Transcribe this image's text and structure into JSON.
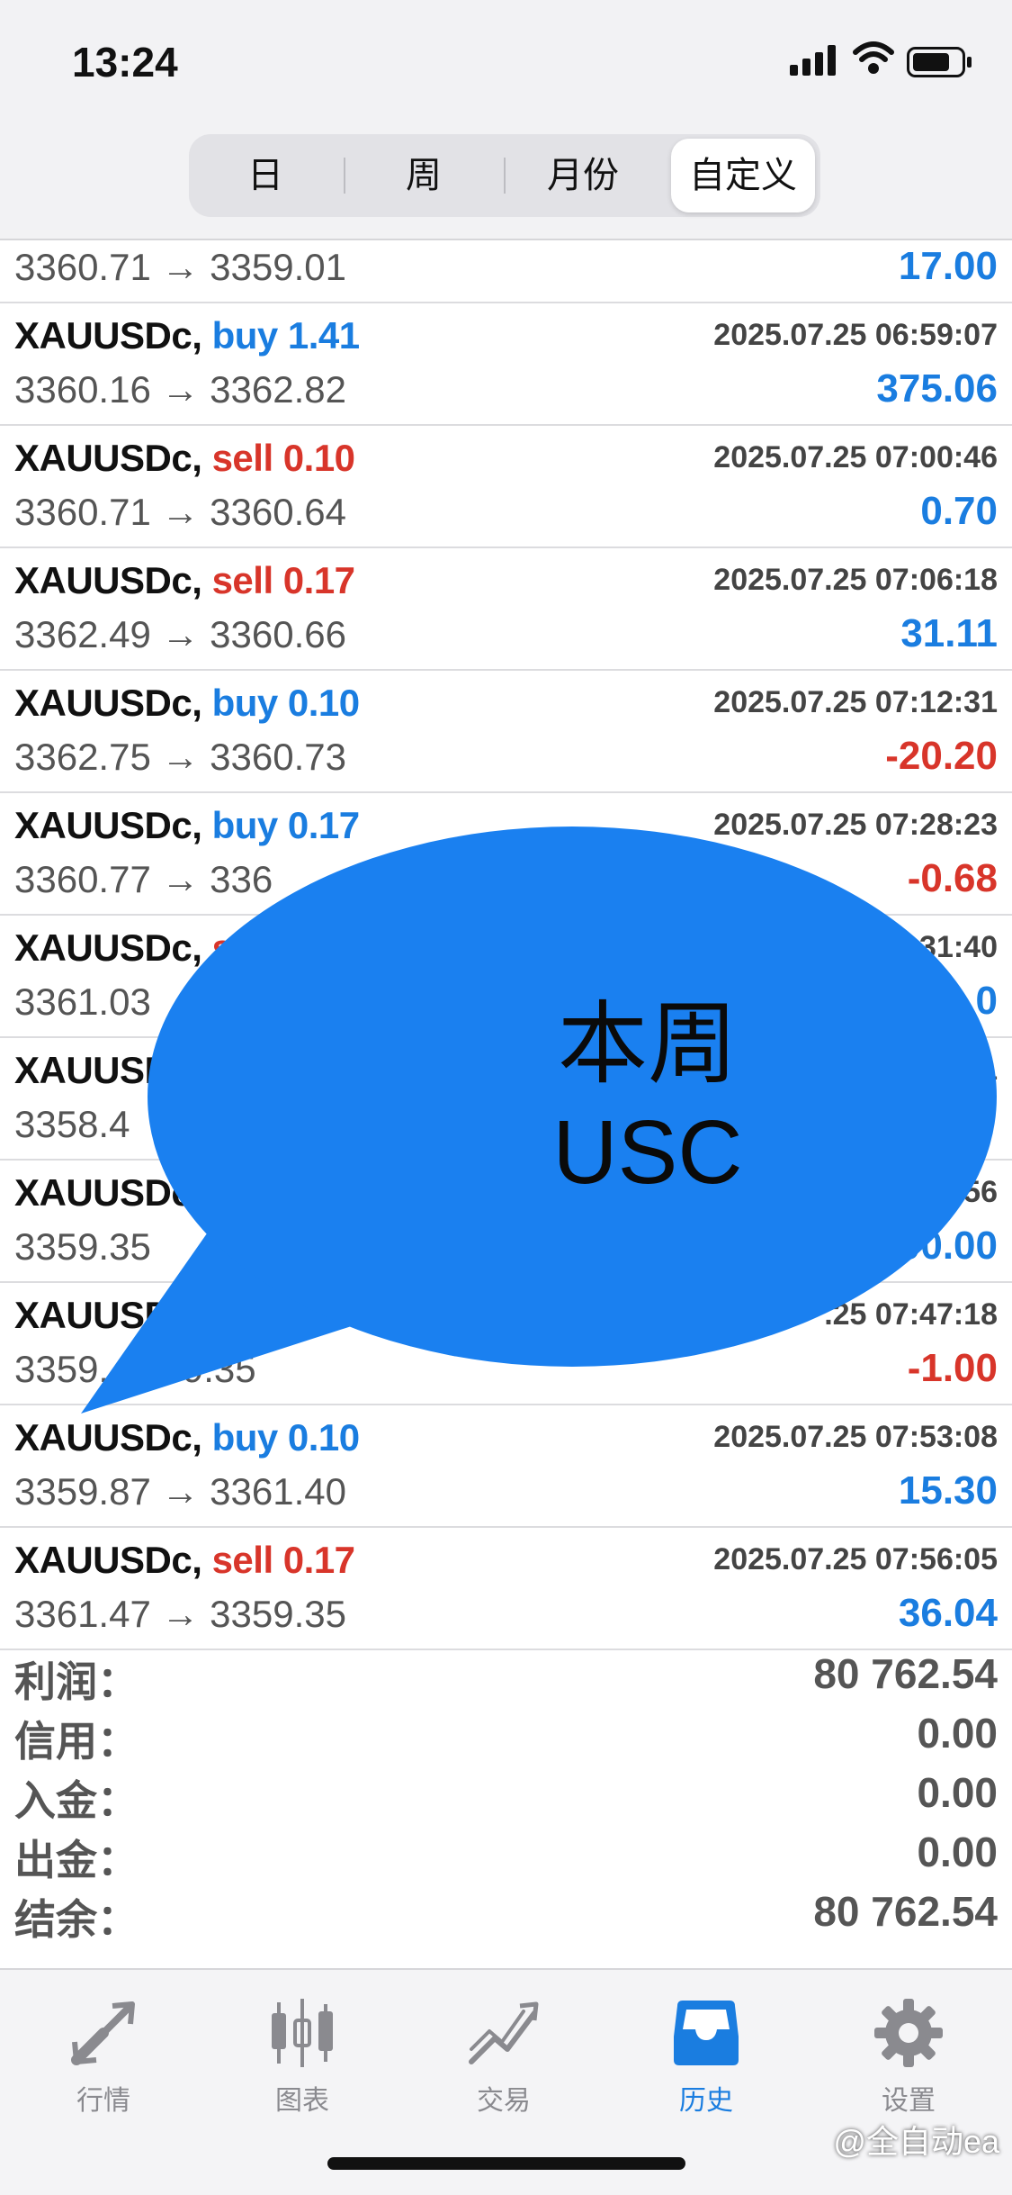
{
  "status": {
    "time": "13:24"
  },
  "segments": {
    "items": [
      "日",
      "周",
      "月份",
      "自定义"
    ],
    "active": "自定义"
  },
  "trades": [
    {
      "symbol": "",
      "side": "",
      "volume": "",
      "datetime": "",
      "prices": "3360.71 → 3359.01",
      "profit": "17.00",
      "profit_sign": "pos"
    },
    {
      "symbol": "XAUUSDc,",
      "side": "buy",
      "volume": "1.41",
      "datetime": "2025.07.25 06:59:07",
      "prices": "3360.16 → 3362.82",
      "profit": "375.06",
      "profit_sign": "pos"
    },
    {
      "symbol": "XAUUSDc,",
      "side": "sell",
      "volume": "0.10",
      "datetime": "2025.07.25 07:00:46",
      "prices": "3360.71 → 3360.64",
      "profit": "0.70",
      "profit_sign": "pos"
    },
    {
      "symbol": "XAUUSDc,",
      "side": "sell",
      "volume": "0.17",
      "datetime": "2025.07.25 07:06:18",
      "prices": "3362.49 → 3360.66",
      "profit": "31.11",
      "profit_sign": "pos"
    },
    {
      "symbol": "XAUUSDc,",
      "side": "buy",
      "volume": "0.10",
      "datetime": "2025.07.25 07:12:31",
      "prices": "3362.75 → 3360.73",
      "profit": "-20.20",
      "profit_sign": "neg"
    },
    {
      "symbol": "XAUUSDc,",
      "side": "buy",
      "volume": "0.17",
      "datetime": "2025.07.25 07:28:23",
      "prices": "3360.77 → 336",
      "profit": "-0.68",
      "profit_sign": "neg"
    },
    {
      "symbol": "XAUUSDc,",
      "side": "se",
      "volume": "",
      "datetime": "31:40",
      "prices": "3361.03",
      "profit": "0",
      "profit_sign": "pos"
    },
    {
      "symbol": "XAUUSD",
      "side": "",
      "volume": "",
      "datetime": "1",
      "prices": "3358.4",
      "profit": "",
      "profit_sign": "pos"
    },
    {
      "symbol": "XAUUSDc,",
      "side": "",
      "volume": "",
      "datetime": "56",
      "prices": "3359.35",
      "profit": "00.00",
      "profit_sign": "pos"
    },
    {
      "symbol": "XAUUSD",
      "side": "",
      "volume": "",
      "datetime": ".25 07:47:18",
      "prices": "3359.    3359.35",
      "profit": "-1.00",
      "profit_sign": "neg"
    },
    {
      "symbol": "XAUUSDc,",
      "side": "buy",
      "volume": "0.10",
      "datetime": "2025.07.25 07:53:08",
      "prices": "3359.87 → 3361.40",
      "profit": "15.30",
      "profit_sign": "pos"
    },
    {
      "symbol": "XAUUSDc,",
      "side": "sell",
      "volume": "0.17",
      "datetime": "2025.07.25 07:56:05",
      "prices": "3361.47 → 3359.35",
      "profit": "36.04",
      "profit_sign": "pos"
    }
  ],
  "summary": [
    {
      "label": "利润：",
      "value": "80 762.54"
    },
    {
      "label": "信用：",
      "value": "0.00"
    },
    {
      "label": "入金：",
      "value": "0.00"
    },
    {
      "label": "出金：",
      "value": "0.00"
    },
    {
      "label": "结余：",
      "value": "80 762.54"
    }
  ],
  "overlay": {
    "line1": "本周",
    "line2": "USC",
    "color": "#1a80f0"
  },
  "tabs": [
    {
      "label": "行情",
      "icon": "quotes-arrows-icon"
    },
    {
      "label": "图表",
      "icon": "candlestick-chart-icon"
    },
    {
      "label": "交易",
      "icon": "trade-line-icon"
    },
    {
      "label": "历史",
      "icon": "history-inbox-icon",
      "active": true
    },
    {
      "label": "设置",
      "icon": "gear-icon"
    }
  ],
  "watermark": "@全自动ea",
  "colors": {
    "accent": "#1a7de0",
    "negative": "#d8352a"
  }
}
